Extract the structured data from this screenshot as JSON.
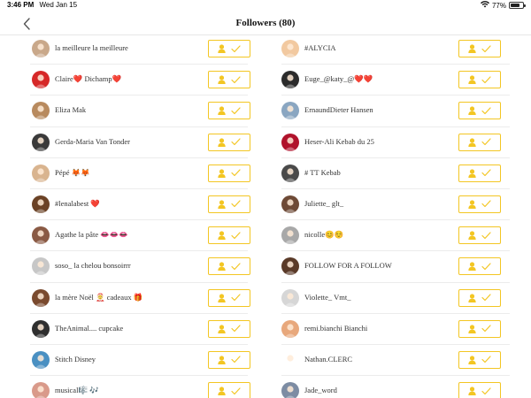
{
  "status_bar": {
    "time": "3:46 PM",
    "date": "Wed Jan 15",
    "wifi_icon": "wifi-icon",
    "battery": "77%",
    "battery_level": 0.77
  },
  "nav": {
    "back_icon": "chevron-left-icon",
    "title": "Followers (80)"
  },
  "accent_color": "#f3c623",
  "follow_button": {
    "icons": [
      "person-icon",
      "checkmark-icon"
    ]
  },
  "followers": {
    "left": [
      {
        "name": "la meilleure la meilleure",
        "avatar_color": "#c9a88a"
      },
      {
        "name": "Claire❤️ Dichamp❤️",
        "avatar_color": "#d62828"
      },
      {
        "name": "Eliza Mak",
        "avatar_color": "#b88a5e"
      },
      {
        "name": "Gerda-Maria Van Tonder",
        "avatar_color": "#3a3a3a"
      },
      {
        "name": "Pépé 🦊🦊",
        "avatar_color": "#d9b48f"
      },
      {
        "name": "#lenalabest ❤️",
        "avatar_color": "#6b4226"
      },
      {
        "name": "Agathe la pâte 👄👄👄",
        "avatar_color": "#8a5a44"
      },
      {
        "name": "soso_ la chelou bonsoirrr",
        "avatar_color": "#c7c7c7"
      },
      {
        "name": "la mère Noël 🤶 cadeaux 🎁",
        "avatar_color": "#7a4a2e"
      },
      {
        "name": "TheAnimal.... cupcake",
        "avatar_color": "#2f2f2f"
      },
      {
        "name": "Stitch Disney",
        "avatar_color": "#4a90c2"
      },
      {
        "name": "musical🎼 🎶",
        "avatar_color": "#d99a8a"
      }
    ],
    "right": [
      {
        "name": "#ALYCIA",
        "avatar_color": "#f2c9a0"
      },
      {
        "name": "Euge_@katy_@❤️❤️",
        "avatar_color": "#2b2b2b"
      },
      {
        "name": "ErnaundDieter Hansen",
        "avatar_color": "#8aa6c1"
      },
      {
        "name": "Heser-Ali Kebab du 25",
        "avatar_color": "#b0122b"
      },
      {
        "name": "# TT Kebab",
        "avatar_color": "#4a4a4a"
      },
      {
        "name": "Juliette_ glt_",
        "avatar_color": "#6e4a36"
      },
      {
        "name": "nicolle😊☺️",
        "avatar_color": "#a8a8a8"
      },
      {
        "name": "FOLLOW FOR A FOLLOW",
        "avatar_color": "#5a3a28"
      },
      {
        "name": "Violette_ Vmt_",
        "avatar_color": "#d6d6d6"
      },
      {
        "name": "remi.bianchi Bianchi",
        "avatar_color": "#e8a87c"
      },
      {
        "name": "Nathan.CLERC",
        "avatar_color": "#ffffff"
      },
      {
        "name": "Jade_word",
        "avatar_color": "#7d8ca3"
      }
    ]
  }
}
